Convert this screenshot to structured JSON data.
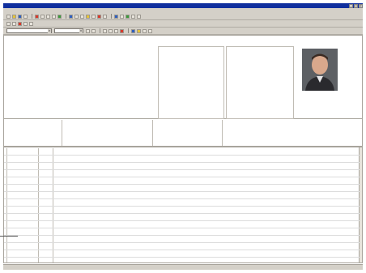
{
  "window": {
    "title": "",
    "controls": {
      "minimize": "_",
      "maximize": "□",
      "close": "×"
    }
  },
  "menu": {
    "items": [
      "",
      "",
      "",
      "",
      "",
      "",
      "",
      "",
      "",
      "",
      ""
    ]
  },
  "toolbar": {
    "patient_selector": "",
    "mode_selector": "",
    "combo_arrow": "▾"
  },
  "patient": {
    "left_labels": [
      "",
      "",
      "",
      "",
      "",
      ""
    ],
    "left_values": [
      "",
      "",
      "",
      "",
      "",
      ""
    ],
    "mid_labels": [
      "",
      "",
      "",
      "",
      "",
      "",
      ""
    ],
    "mid_values": [
      "",
      "",
      "",
      "",
      "",
      "",
      ""
    ],
    "diagnoses_label": "",
    "diagnoses_text": "",
    "permanent_diagnoses_label": "",
    "permanent_diagnoses_text": "",
    "photo": "patient-photo"
  },
  "infobar": {
    "contraindications_label": "",
    "allergies_label": "",
    "cave_label": "",
    "cave_value": "",
    "family_label": "",
    "family_value": ""
  },
  "entries": [
    {
      "date": "",
      "type": "",
      "text": "",
      "style": "gray"
    },
    {
      "date": "",
      "type": "",
      "text": "",
      "style": "red"
    },
    {
      "date": "",
      "type": "",
      "text": "",
      "style": "red"
    },
    {
      "date": "",
      "type": "",
      "text": "",
      "style": "gray"
    },
    {
      "date": "",
      "type": "",
      "text": "",
      "style": "blue"
    },
    {
      "date": "",
      "type": "",
      "text": "",
      "style": "red"
    },
    {
      "date": "",
      "type": "",
      "text": "",
      "style": "red"
    },
    {
      "date": "",
      "type": "",
      "text": "",
      "style": "gray"
    },
    {
      "date": "",
      "type": "",
      "text": "",
      "style": "red"
    },
    {
      "date": "",
      "type": "",
      "text": "",
      "style": "blue"
    },
    {
      "date": "",
      "type": "",
      "text": "",
      "style": "red"
    },
    {
      "date": "",
      "type": "",
      "text": "",
      "style": "dark"
    },
    {
      "date": "",
      "type": "",
      "text": "",
      "style": "gray"
    },
    {
      "date": "",
      "type": "",
      "text": "",
      "style": "gray"
    },
    {
      "date": "",
      "type": "",
      "text": "",
      "style": "red"
    },
    {
      "date": "",
      "type": "",
      "text": "",
      "style": "gray"
    }
  ],
  "status": {
    "left": "",
    "right": ""
  },
  "colors": {
    "titlebar": "#102f9e",
    "entry_red": "#c6281c",
    "entry_blue": "#1a2f9a",
    "diagnosis_red": "#d0382a",
    "permanent_teal": "#2a8a86",
    "chrome_gray": "#d4d0c8"
  }
}
